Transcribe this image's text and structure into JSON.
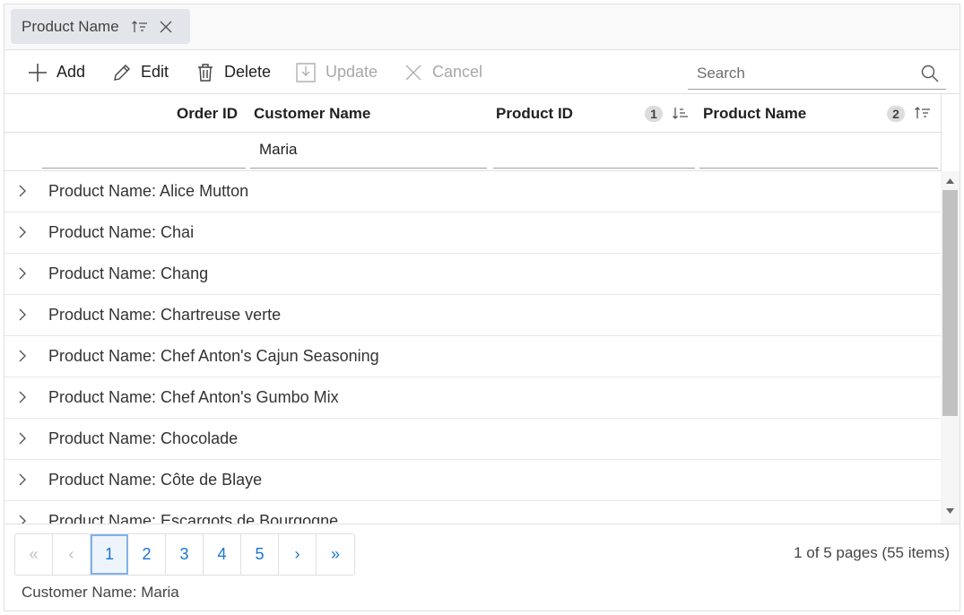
{
  "group_area": {
    "chip_label": "Product Name"
  },
  "toolbar": {
    "add": "Add",
    "edit": "Edit",
    "delete": "Delete",
    "update": "Update",
    "cancel": "Cancel",
    "search_placeholder": "Search"
  },
  "columns": {
    "order_id": "Order ID",
    "customer_name": "Customer Name",
    "product_id": "Product ID",
    "product_id_sort_index": "1",
    "product_name": "Product Name",
    "product_name_sort_index": "2"
  },
  "filters": {
    "order_id": "",
    "customer_name": "Maria",
    "product_id": "",
    "product_name": ""
  },
  "groups": [
    "Product Name: Alice Mutton",
    "Product Name: Chai",
    "Product Name: Chang",
    "Product Name: Chartreuse verte",
    "Product Name: Chef Anton's Cajun Seasoning",
    "Product Name: Chef Anton's Gumbo Mix",
    "Product Name: Chocolade",
    "Product Name: Côte de Blaye",
    "Product Name: Escargots de Bourgogne"
  ],
  "pager": {
    "first": "«",
    "prev": "‹",
    "pages": [
      "1",
      "2",
      "3",
      "4",
      "5"
    ],
    "current": "1",
    "next": "›",
    "last": "»",
    "info": "1 of 5 pages (55 items)"
  },
  "footer": {
    "filter_summary": "Customer Name: Maria"
  },
  "colors": {
    "accent": "#1976d2",
    "chip_bg": "#e2e5ea",
    "scroll_thumb": "#c1c1c1"
  }
}
